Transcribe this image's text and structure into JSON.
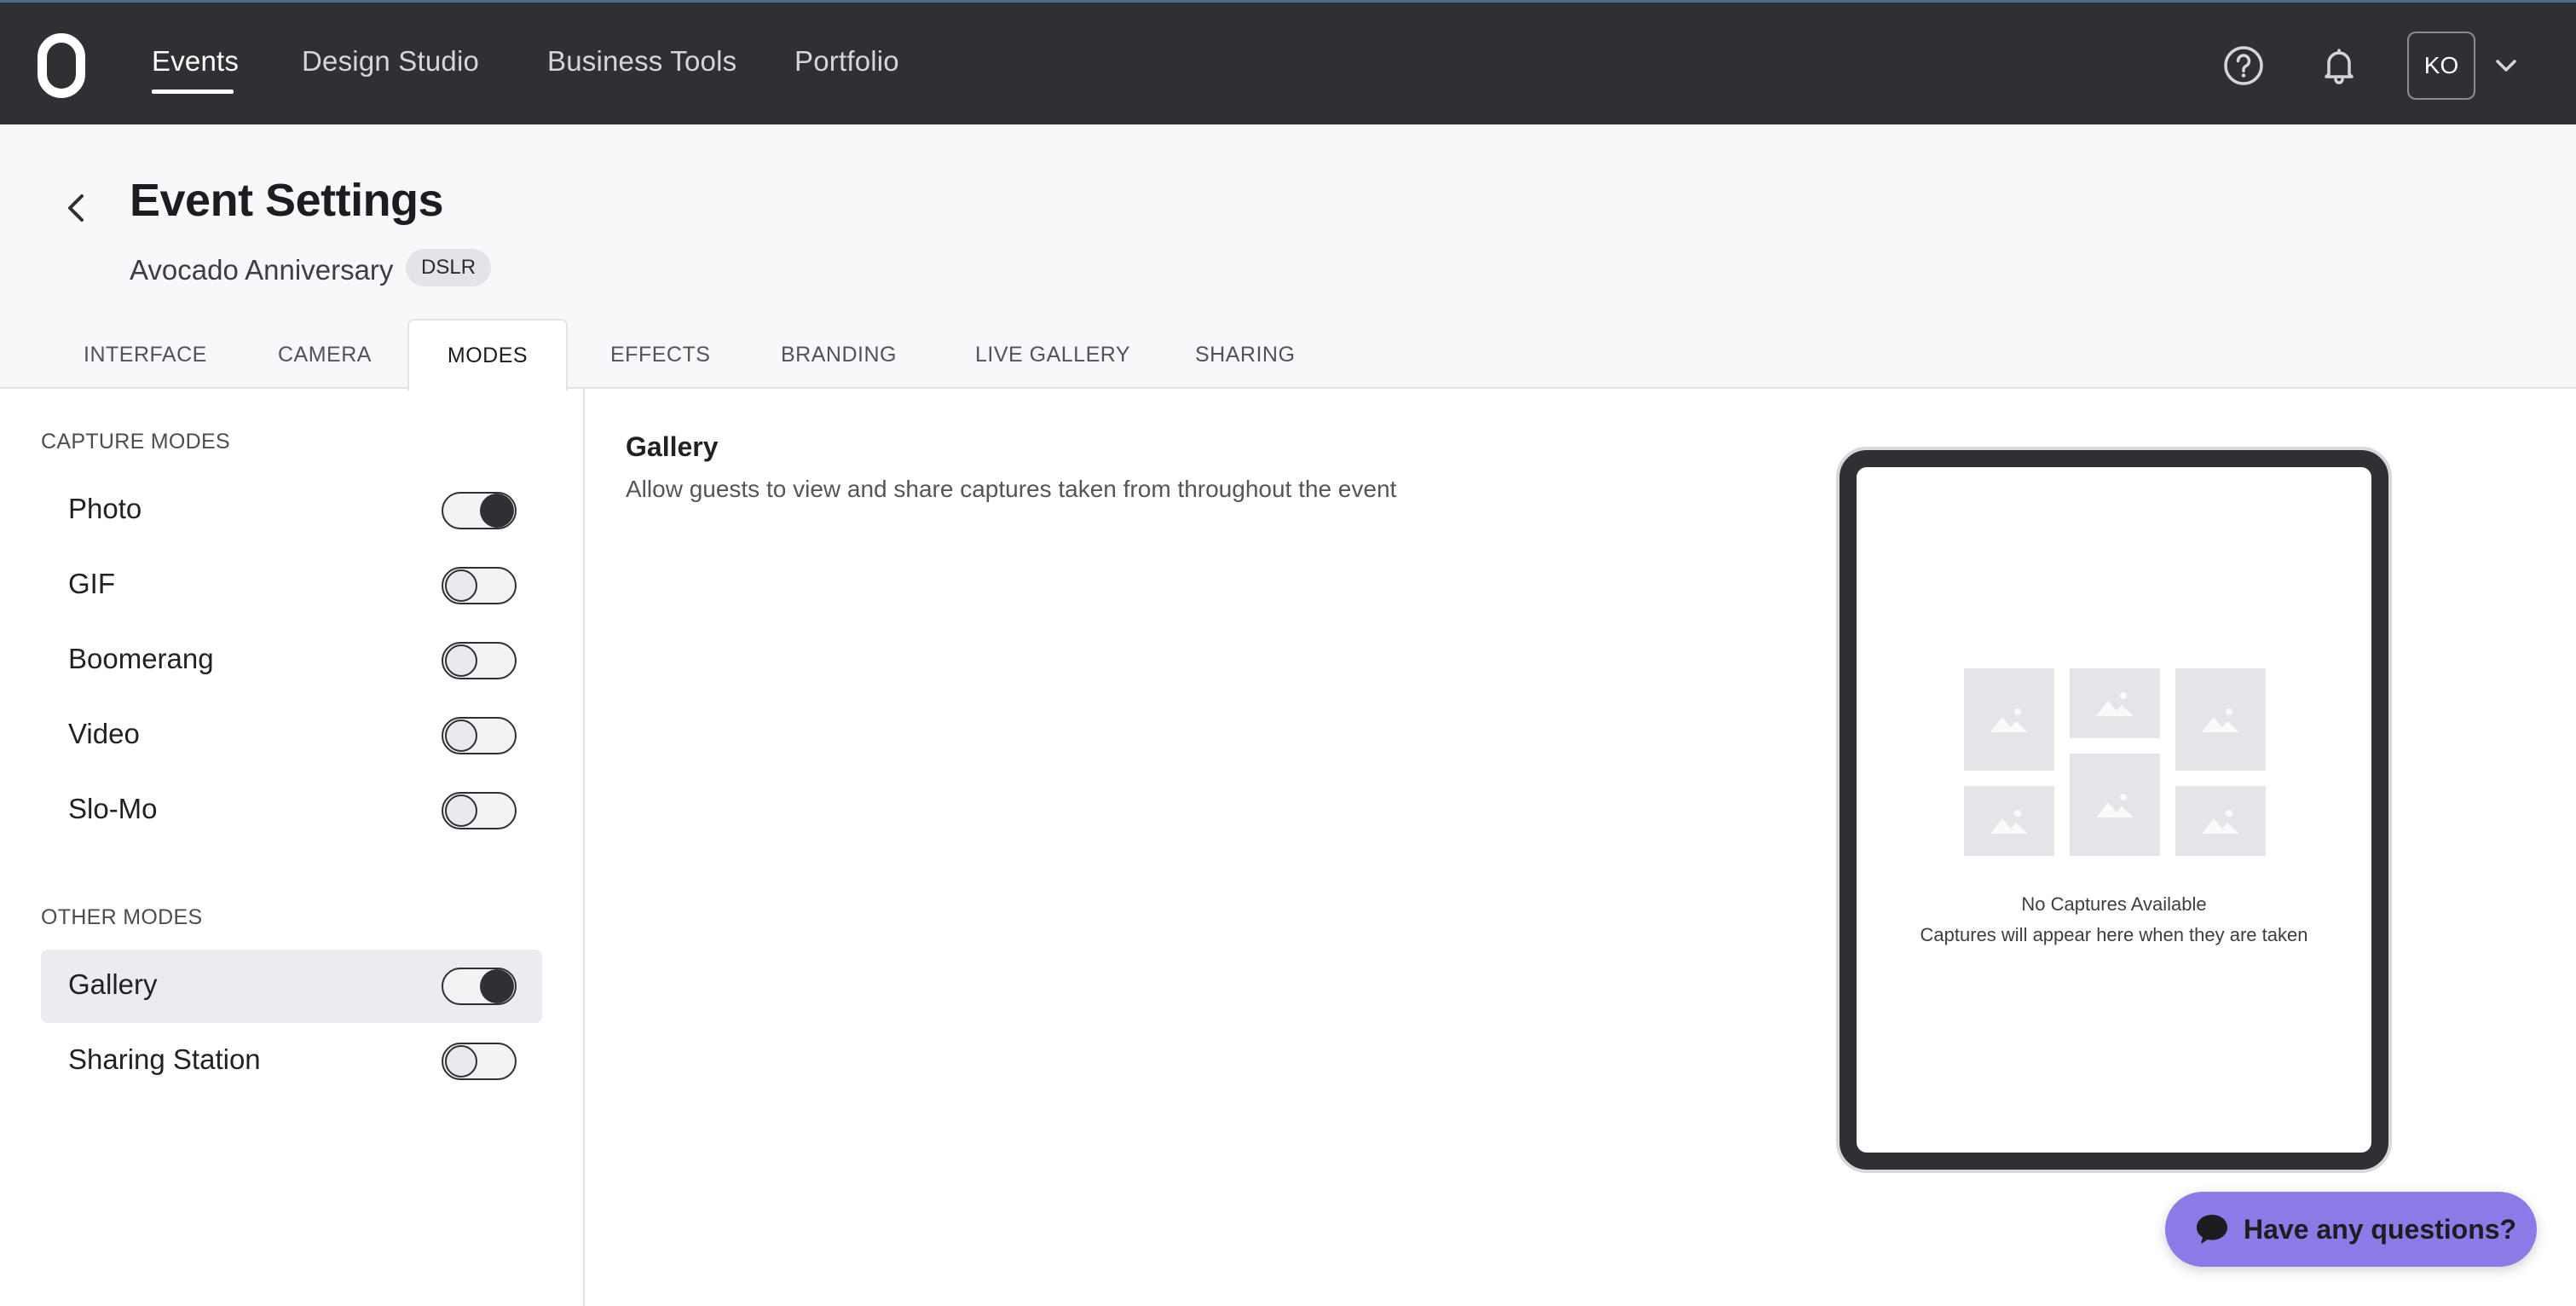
{
  "nav": {
    "items": [
      {
        "label": "Events",
        "active": true
      },
      {
        "label": "Design Studio"
      },
      {
        "label": "Business Tools"
      },
      {
        "label": "Portfolio"
      }
    ],
    "user_initials": "KO"
  },
  "header": {
    "title": "Event Settings",
    "event_name": "Avocado Anniversary",
    "badge": "DSLR"
  },
  "tabs": [
    {
      "label": "INTERFACE"
    },
    {
      "label": "CAMERA"
    },
    {
      "label": "MODES",
      "active": true
    },
    {
      "label": "EFFECTS"
    },
    {
      "label": "BRANDING"
    },
    {
      "label": "LIVE GALLERY"
    },
    {
      "label": "SHARING"
    }
  ],
  "sidebar": {
    "capture_label": "CAPTURE MODES",
    "capture_modes": [
      {
        "label": "Photo",
        "enabled": true
      },
      {
        "label": "GIF",
        "enabled": false
      },
      {
        "label": "Boomerang",
        "enabled": false
      },
      {
        "label": "Video",
        "enabled": false
      },
      {
        "label": "Slo-Mo",
        "enabled": false
      }
    ],
    "other_label": "OTHER MODES",
    "other_modes": [
      {
        "label": "Gallery",
        "enabled": true,
        "selected": true
      },
      {
        "label": "Sharing Station",
        "enabled": false
      }
    ]
  },
  "content": {
    "title": "Gallery",
    "description": "Allow guests to view and share captures taken from throughout the event"
  },
  "preview": {
    "empty_title": "No Captures Available",
    "empty_subtitle": "Captures will appear here when they are taken"
  },
  "chat": {
    "label": "Have any questions?",
    "color": "#8b7be6"
  }
}
